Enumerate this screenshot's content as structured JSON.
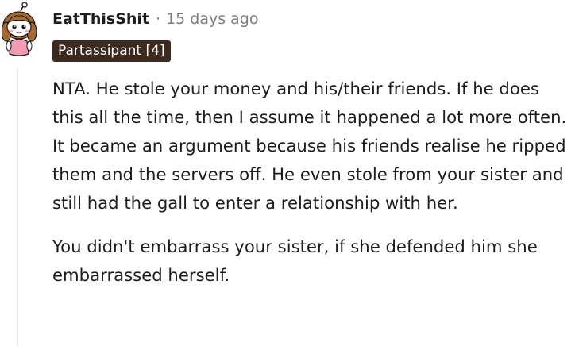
{
  "comment": {
    "author": "EatThisShit",
    "separator": "·",
    "timestamp": "15 days ago",
    "flair": "Partassipant [4]",
    "paragraphs": [
      "NTA. He stole your money and his/their friends. If he does this all the time, then I assume it happened a lot more often. It became an argument because his friends realise he ripped them and the servers off. He even stole from your sister and still had the gall to enter a relationship with her.",
      "You didn't embarrass your sister, if she defended him she embarrassed herself."
    ]
  },
  "colors": {
    "flair_background": "#3d2a1e",
    "meta_text": "#7c7c7c",
    "thread_line": "#e8eaec"
  },
  "icons": {
    "avatar": "snoo-avatar-girl-icon"
  }
}
